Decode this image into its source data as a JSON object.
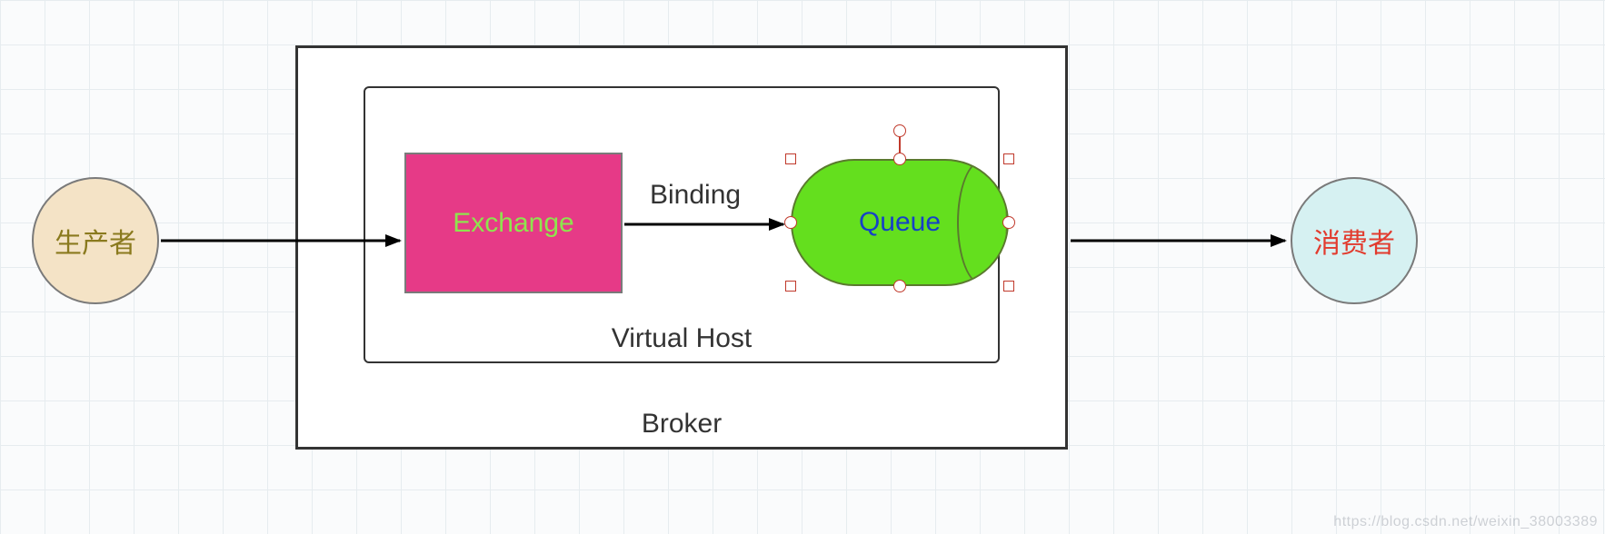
{
  "diagram": {
    "producer_label": "生产者",
    "consumer_label": "消费者",
    "broker_label": "Broker",
    "vhost_label": "Virtual Host",
    "exchange_label": "Exchange",
    "queue_label": "Queue",
    "binding_label": "Binding",
    "colors": {
      "producer_fill": "#f4e3c6",
      "producer_text": "#8a7a1e",
      "consumer_fill": "#d6f1f2",
      "consumer_text": "#e23b2e",
      "exchange_fill": "#e63a87",
      "exchange_text": "#8ee44e",
      "queue_fill": "#64df1e",
      "queue_text": "#1641c7",
      "selection_handle": "#c0392b"
    }
  },
  "watermark": "https://blog.csdn.net/weixin_38003389"
}
